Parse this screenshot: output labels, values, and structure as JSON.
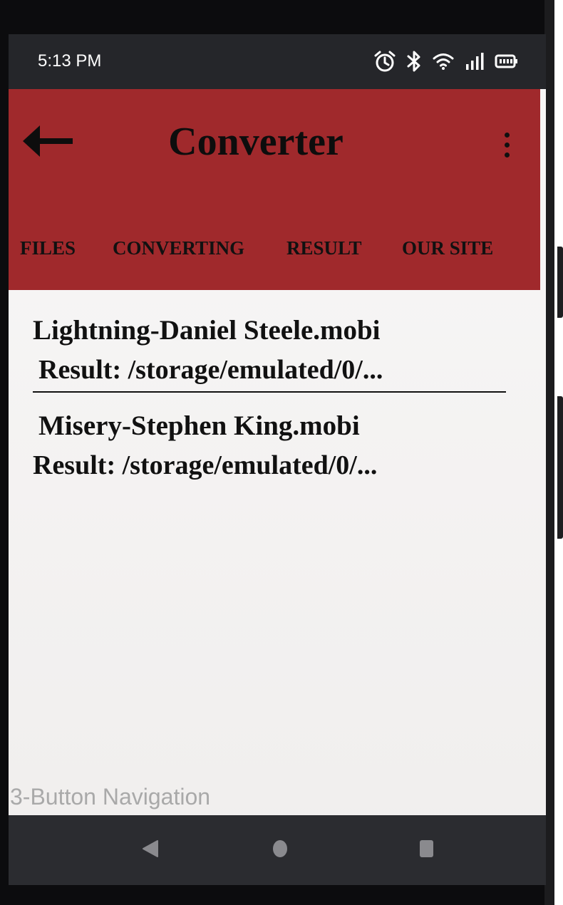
{
  "status_bar": {
    "time": "5:13 PM",
    "icons": [
      "alarm-icon",
      "bluetooth-icon",
      "wifi-icon",
      "signal-icon",
      "battery-icon"
    ]
  },
  "app_bar": {
    "title": "Converter",
    "back_icon": "arrow-left-icon",
    "menu_icon": "more-vert-icon"
  },
  "tabs": [
    {
      "label": "FILES"
    },
    {
      "label": "CONVERTING"
    },
    {
      "label": "RESULT"
    },
    {
      "label": "OUR SITE"
    }
  ],
  "results": [
    {
      "title": "Lightning-Daniel Steele.mobi",
      "result": "Result: /storage/emulated/0/..."
    },
    {
      "title": "Misery-Stephen King.mobi",
      "result": "Result: /storage/emulated/0/..."
    }
  ],
  "navigation": {
    "hint": "3-Button Navigation",
    "buttons": [
      "back-triangle-icon",
      "home-circle-icon",
      "recents-square-icon"
    ]
  },
  "colors": {
    "app_bar": "#a0292c",
    "status_bar": "#25262a",
    "nav_bar": "#2b2c30",
    "text": "#111111"
  }
}
